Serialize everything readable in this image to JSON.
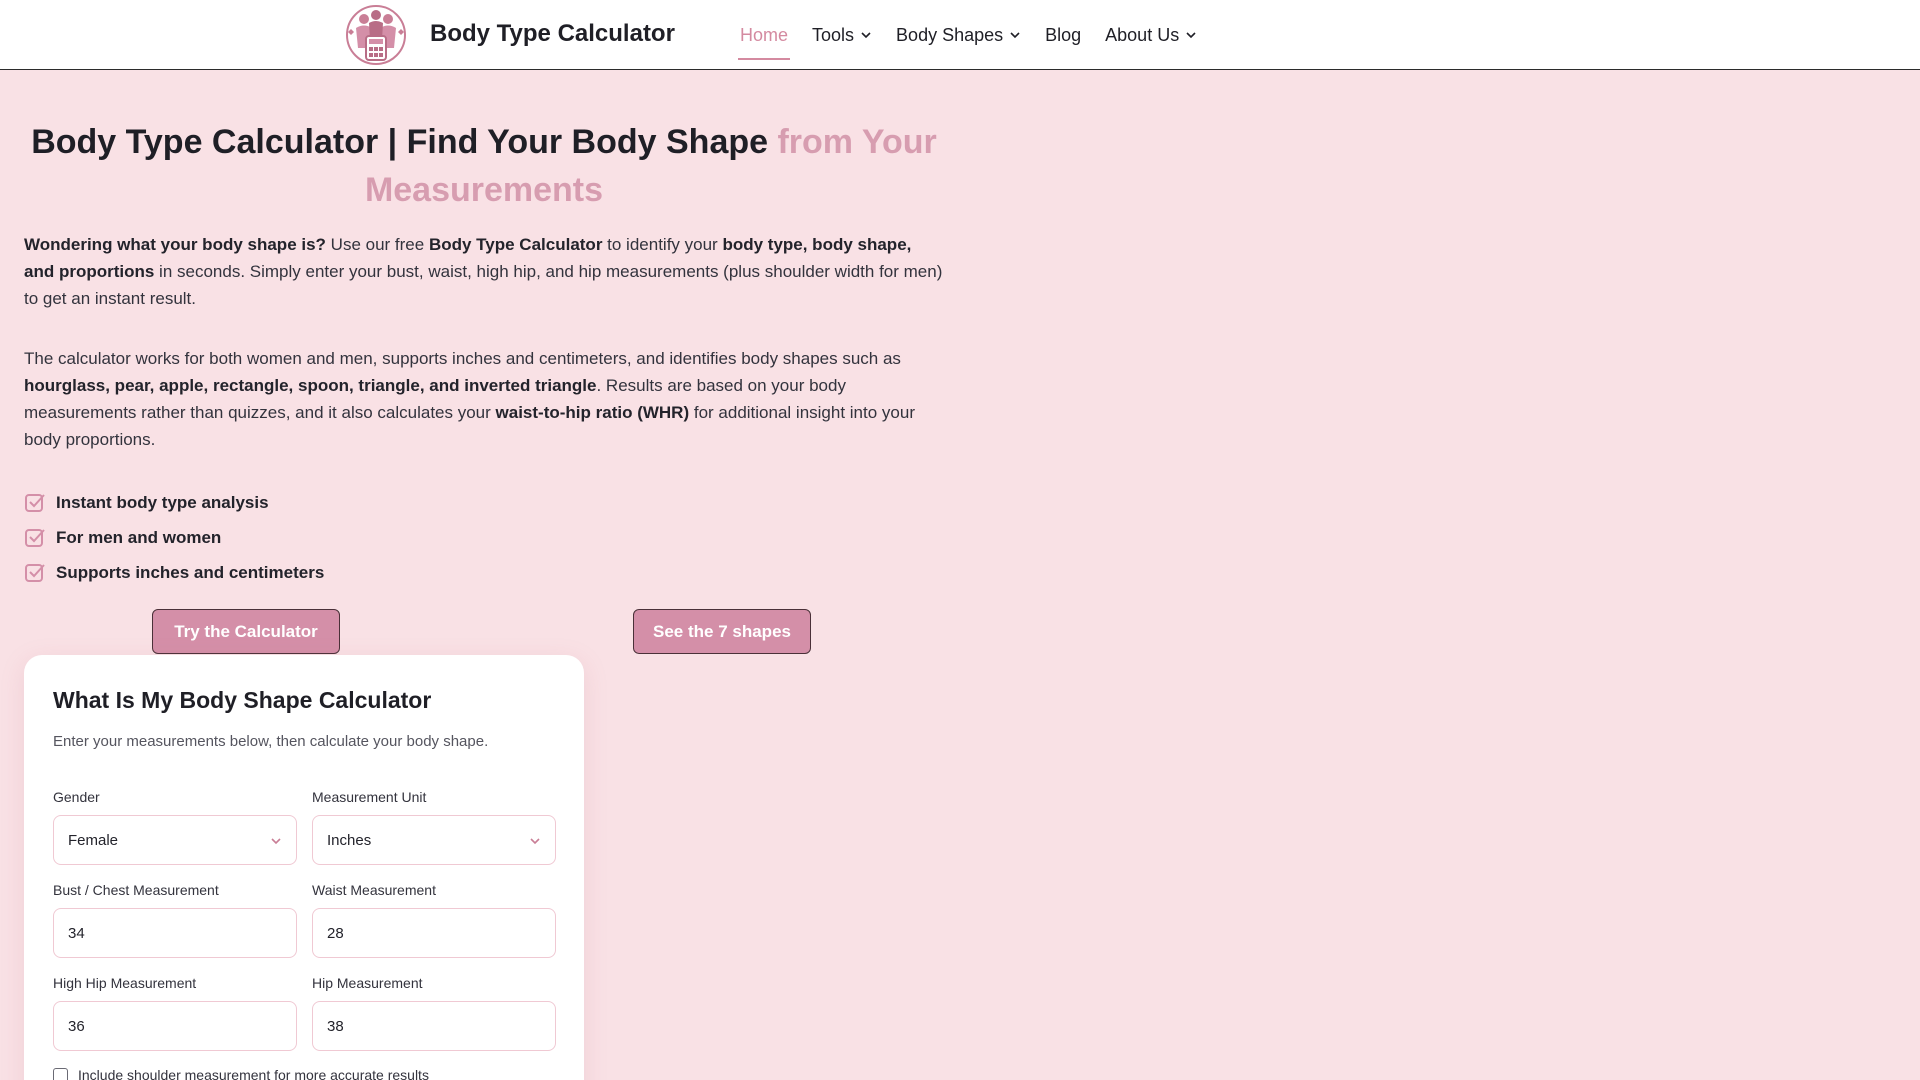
{
  "header": {
    "site_title": "Body Type Calculator",
    "nav": [
      {
        "label": "Home",
        "active": true,
        "dropdown": false
      },
      {
        "label": "Tools",
        "active": false,
        "dropdown": true
      },
      {
        "label": "Body Shapes",
        "active": false,
        "dropdown": true
      },
      {
        "label": "Blog",
        "active": false,
        "dropdown": false
      },
      {
        "label": "About Us",
        "active": false,
        "dropdown": true
      }
    ]
  },
  "hero": {
    "title_main": "Body Type Calculator | Find Your Body Shape",
    "title_accent": "from Your Measurements",
    "p1": {
      "s1": "Wondering what your body shape is?",
      "s2": " Use our free ",
      "s3": "Body Type Calculator",
      "s4": " to identify your ",
      "s5": "body type, body shape, and proportions",
      "s6": " in seconds. Simply enter your bust, waist, high hip, and hip measurements (plus shoulder width for men) to get an instant result."
    },
    "p2": {
      "s1": "The calculator works for both women and men, supports inches and centimeters, and identifies body shapes such as ",
      "s2": "hourglass, pear, apple, rectangle, spoon, triangle, and inverted triangle",
      "s3": ". Results are based on your body measurements rather than quizzes, and it also calculates your ",
      "s4": "waist-to-hip ratio (WHR)",
      "s5": " for additional insight into your body proportions."
    },
    "features": [
      "Instant body type analysis",
      "For men and women",
      "Supports inches and centimeters"
    ],
    "cta_primary": "Try the Calculator",
    "cta_secondary": "See the 7 shapes"
  },
  "calculator": {
    "title": "What Is My Body Shape Calculator",
    "subtitle": "Enter your measurements below, then calculate your body shape.",
    "gender": {
      "label": "Gender",
      "value": "Female"
    },
    "unit": {
      "label": "Measurement Unit",
      "value": "Inches"
    },
    "bust": {
      "label": "Bust / Chest Measurement",
      "value": "34"
    },
    "waist": {
      "label": "Waist Measurement",
      "value": "28"
    },
    "high_hip": {
      "label": "High Hip Measurement",
      "value": "36"
    },
    "hip": {
      "label": "Hip Measurement",
      "value": "38"
    },
    "shoulder_checkbox": "Include shoulder measurement for more accurate results"
  },
  "colors": {
    "accent": "#d48fa8",
    "background": "#f9e1e5"
  }
}
